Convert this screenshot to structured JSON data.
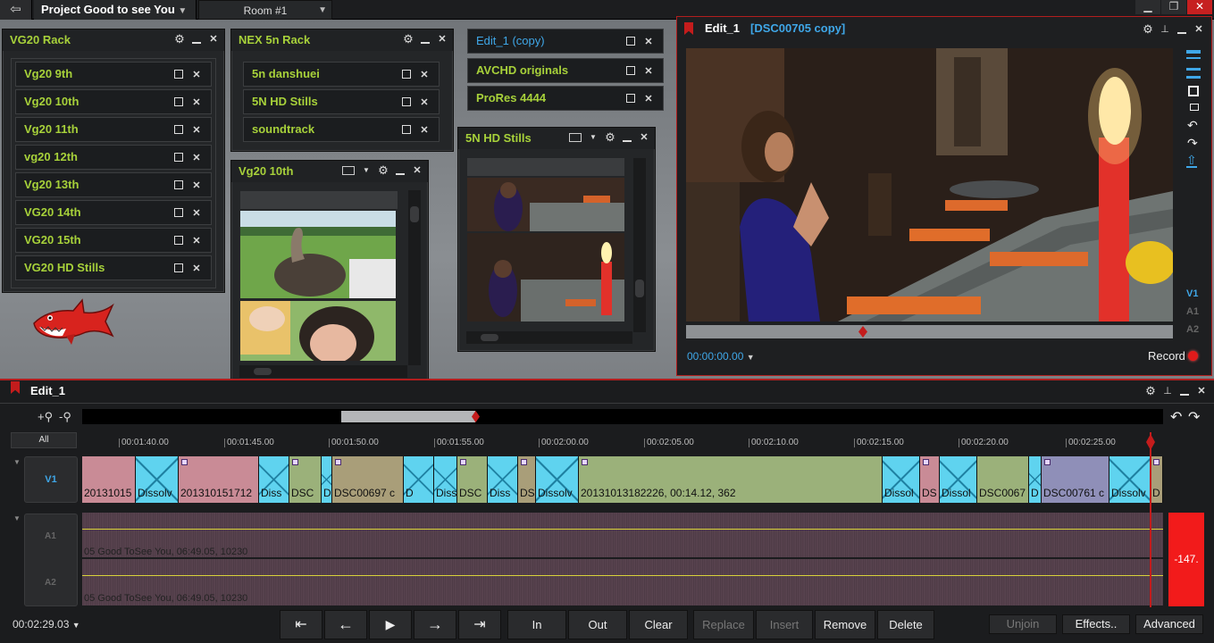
{
  "topbar": {
    "project": "Project Good to see You",
    "room": "Room #1",
    "exit_icon": "exit-icon"
  },
  "racks": {
    "vg20": {
      "title": "VG20 Rack",
      "bins": [
        "Vg20 9th",
        "Vg20 10th",
        "Vg20 11th",
        "vg20 12th",
        "Vg20 13th",
        "VG20 14th",
        "VG20 15th",
        "VG20 HD Stills"
      ]
    },
    "nex": {
      "title": "NEX 5n Rack",
      "bins": [
        "5n danshuei",
        "5N HD Stills",
        "soundtrack"
      ]
    },
    "misc": {
      "bins": [
        "Edit_1 (copy)",
        "AVCHD originals",
        "ProRes 4444"
      ]
    }
  },
  "bins": {
    "vg20_10th": "Vg20 10th",
    "nex_stills": "5N HD Stills"
  },
  "viewer": {
    "title": "Edit_1",
    "subtitle": "[DSC00705 copy]",
    "timecode": "00:00:00.00",
    "record": "Record",
    "tracks": [
      "V1",
      "A1",
      "A2"
    ],
    "record_color": "#e01b1b"
  },
  "timeline": {
    "title": "Edit_1",
    "all_label": "All",
    "ticks": [
      "00:01:40.00",
      "00:01:45.00",
      "00:01:50.00",
      "00:01:55.00",
      "00:02:00.00",
      "00:02:05.00",
      "00:02:10.00",
      "00:02:15.00",
      "00:02:20.00",
      "00:02:25.00"
    ],
    "tracks": {
      "v1": "V1",
      "a1": "A1",
      "a2": "A2"
    },
    "clips": [
      "20131015",
      "Dissolv",
      "201310151712",
      "Diss",
      "DSC",
      "D",
      "DSC00697 c",
      "D",
      "Diss",
      "DSC",
      "Diss",
      "DS",
      "Dissolv",
      "20131013182226, 00:14.12, 362",
      "Dissol",
      "DS",
      "Dissol",
      "DSC0067",
      "D",
      "DSC00761 c",
      "Dissolv",
      "D"
    ],
    "audio_a1": "05 Good ToSee You, 06:49.05, 10230",
    "audio_a2": "05 Good ToSee You, 06:49.05, 10230",
    "meter": "-147.",
    "timecode": "00:02:29.03",
    "buttons": {
      "in": "In",
      "out": "Out",
      "clear": "Clear",
      "replace": "Replace",
      "insert": "Insert",
      "remove": "Remove",
      "delete": "Delete",
      "unjoin": "Unjoin",
      "effects": "Effects..",
      "advanced": "Advanced"
    }
  }
}
